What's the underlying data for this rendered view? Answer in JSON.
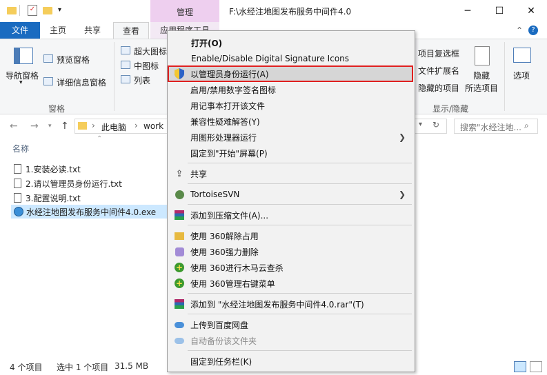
{
  "title_bar": {
    "manage_tab": "管理",
    "window_title": "F:\\水经注地图发布服务中间件4.0",
    "qa_dropdown": "▾",
    "minimize": "─",
    "maximize": "☐",
    "close": "✕"
  },
  "ribbon_tabs": {
    "file": "文件",
    "home": "主页",
    "share": "共享",
    "view": "查看",
    "app_tools": "应用程序工具",
    "collapse_icon": "⌃",
    "help_icon": "?"
  },
  "ribbon": {
    "nav_pane": "导航窗格",
    "preview_pane": "预览窗格",
    "details_pane": "详细信息窗格",
    "pane_group": "窗格",
    "extra_large_icons": "超大图标",
    "medium_icons": "中图标",
    "list": "列表",
    "item_checkboxes": "项目复选框",
    "file_extensions": "文件扩展名",
    "hidden_items": "隐藏的项目",
    "hide_selected": "隐藏",
    "hide_selected_2": "所选项目",
    "options": "选项",
    "show_hide_group": "显示/隐藏"
  },
  "address": {
    "this_pc": "此电脑",
    "work": "work",
    "search_placeholder": "搜索\"水经注地..."
  },
  "files": {
    "column_name": "名称",
    "items": [
      {
        "name": "1.安装必读.txt"
      },
      {
        "name": "2.请以管理员身份运行.txt"
      },
      {
        "name": "3.配置说明.txt"
      },
      {
        "name": "水经注地图发布服务中间件4.0.exe"
      }
    ]
  },
  "status": {
    "count": "4 个项目",
    "selected": "选中 1 个项目",
    "size": "31.5 MB"
  },
  "context_menu": {
    "open": "打开(O)",
    "signature_icons": "Enable/Disable Digital Signature Icons",
    "run_as_admin": "以管理员身份运行(A)",
    "toggle_signature_cn": "启用/禁用数字签名图标",
    "open_with_notepad": "用记事本打开该文件",
    "troubleshoot": "兼容性疑难解答(Y)",
    "gpu_run": "用图形处理器运行",
    "pin_start": "固定到\"开始\"屏幕(P)",
    "share": "共享",
    "tortoise": "TortoiseSVN",
    "add_archive": "添加到压缩文件(A)...",
    "unlock_360": "使用 360解除占用",
    "force_delete_360": "使用 360强力删除",
    "trojan_scan_360": "使用 360进行木马云查杀",
    "manage_menu_360": "使用 360管理右键菜单",
    "add_rar": "添加到 \"水经注地图发布服务中间件4.0.rar\"(T)",
    "upload_baidu": "上传到百度网盘",
    "auto_backup": "自动备份该文件夹",
    "pin_taskbar": "固定到任务栏(K)"
  },
  "colors": {
    "file_tab": "#1a6bc0",
    "manage_tab": "#eecfef",
    "selection": "#cce8ff",
    "highlight_border": "#e02020"
  }
}
